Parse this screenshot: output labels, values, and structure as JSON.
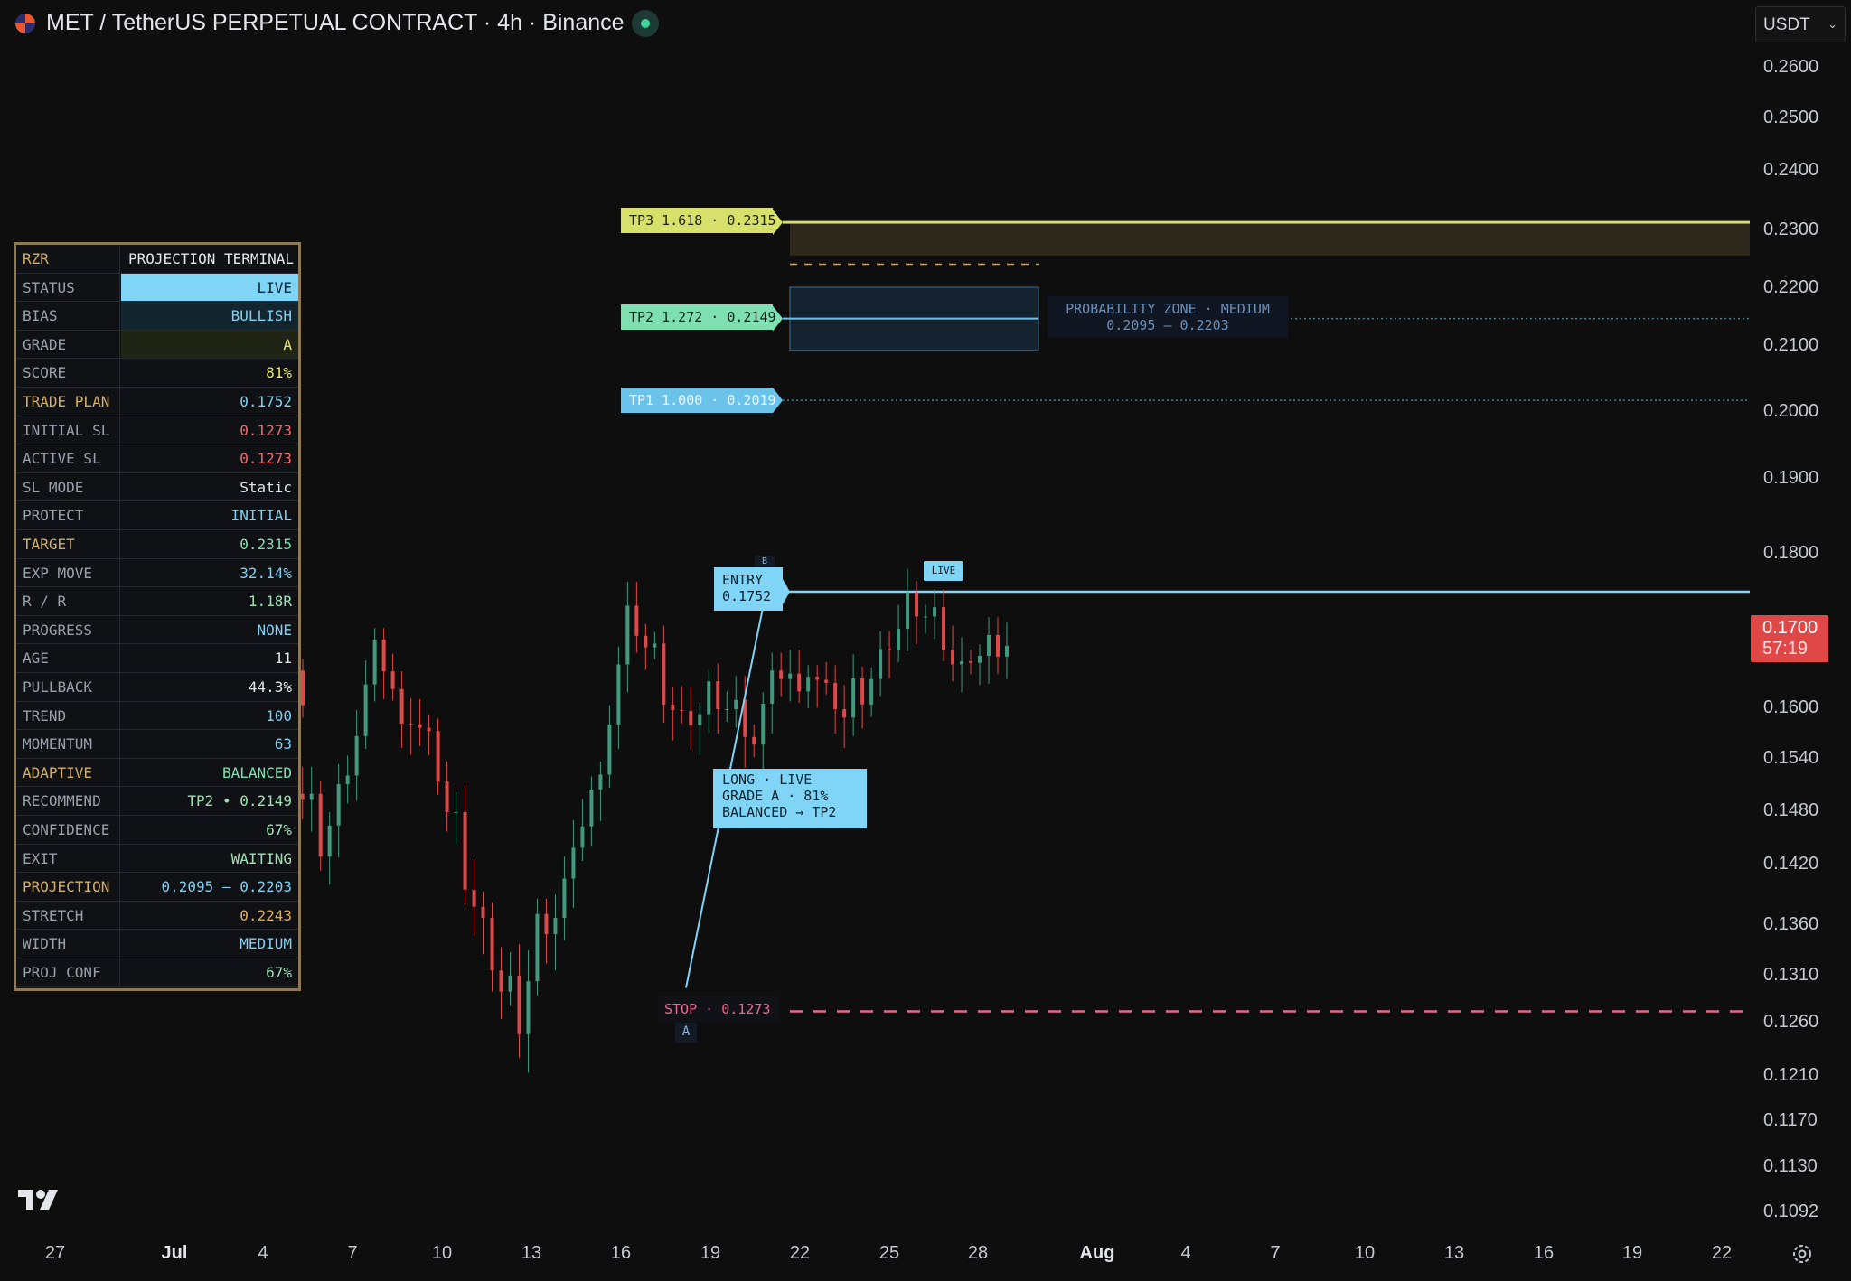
{
  "header": {
    "title": "MET / TetherUS PERPETUAL CONTRACT · 4h · Binance",
    "currency": "USDT"
  },
  "price_axis": {
    "ticks": [
      "0.2600",
      "0.2500",
      "0.2400",
      "0.2300",
      "0.2200",
      "0.2100",
      "0.2000",
      "0.1900",
      "0.1800",
      "0.1600",
      "0.1540",
      "0.1480",
      "0.1420",
      "0.1360",
      "0.1310",
      "0.1260",
      "0.1210",
      "0.1170",
      "0.1130",
      "0.1092"
    ],
    "last_price": "0.1700",
    "countdown": "57:19"
  },
  "time_axis": {
    "ticks": [
      {
        "label": "27",
        "bold": false
      },
      {
        "label": "Jul",
        "bold": true
      },
      {
        "label": "4",
        "bold": false
      },
      {
        "label": "7",
        "bold": false
      },
      {
        "label": "10",
        "bold": false
      },
      {
        "label": "13",
        "bold": false
      },
      {
        "label": "16",
        "bold": false
      },
      {
        "label": "19",
        "bold": false
      },
      {
        "label": "22",
        "bold": false
      },
      {
        "label": "25",
        "bold": false
      },
      {
        "label": "28",
        "bold": false
      },
      {
        "label": "Aug",
        "bold": true
      },
      {
        "label": "4",
        "bold": false
      },
      {
        "label": "7",
        "bold": false
      },
      {
        "label": "10",
        "bold": false
      },
      {
        "label": "13",
        "bold": false
      },
      {
        "label": "16",
        "bold": false
      },
      {
        "label": "19",
        "bold": false
      },
      {
        "label": "22",
        "bold": false
      }
    ]
  },
  "overlay": {
    "tp3": "TP3 1.618 · 0.2315",
    "tp2": "TP2 1.272 · 0.2149",
    "tp1": "TP1 1.000 · 0.2019",
    "zone_line1": "PROBABILITY ZONE · MEDIUM",
    "zone_line2": "0.2095 — 0.2203",
    "entry_line1": "ENTRY",
    "entry_line2": "0.1752",
    "live_tag": "LIVE",
    "signal_line1": "LONG · LIVE",
    "signal_line2": "GRADE A · 81%",
    "signal_line3": "BALANCED → TP2",
    "stop": "STOP · 0.1273",
    "point_a": "A",
    "point_b": "B"
  },
  "terminal": {
    "header_key": "RZR",
    "header_value": "PROJECTION TERMINAL",
    "rows": [
      {
        "key": "STATUS",
        "value": "LIVE",
        "kc": "#9aa0ab",
        "vc": "#0e2230",
        "bg": "#80d4f6"
      },
      {
        "key": "BIAS",
        "value": "BULLISH",
        "kc": "#9aa0ab",
        "vc": "#7fd0f2",
        "bg": "#13252e"
      },
      {
        "key": "GRADE",
        "value": "A",
        "kc": "#9aa0ab",
        "vc": "#e6e46a",
        "bg": "#1f2414"
      },
      {
        "key": "SCORE",
        "value": "81%",
        "kc": "#9aa0ab",
        "vc": "#e6e46a",
        "bg": ""
      },
      {
        "key": "TRADE PLAN",
        "value": "0.1752",
        "kc": "#d4b066",
        "vc": "#7fd0f2",
        "bg": ""
      },
      {
        "key": "INITIAL SL",
        "value": "0.1273",
        "kc": "#9aa0ab",
        "vc": "#ef6b6b",
        "bg": ""
      },
      {
        "key": "ACTIVE SL",
        "value": "0.1273",
        "kc": "#9aa0ab",
        "vc": "#ef6b6b",
        "bg": ""
      },
      {
        "key": "SL MODE",
        "value": "Static",
        "kc": "#9aa0ab",
        "vc": "#e3e5ea",
        "bg": ""
      },
      {
        "key": "PROTECT",
        "value": "INITIAL",
        "kc": "#9aa0ab",
        "vc": "#7fd0f2",
        "bg": ""
      },
      {
        "key": "TARGET",
        "value": "0.2315",
        "kc": "#d4b066",
        "vc": "#7ee0b0",
        "bg": ""
      },
      {
        "key": "EXP MOVE",
        "value": "32.14%",
        "kc": "#9aa0ab",
        "vc": "#7fd0f2",
        "bg": ""
      },
      {
        "key": "R / R",
        "value": "1.18R",
        "kc": "#9aa0ab",
        "vc": "#9ee0b4",
        "bg": ""
      },
      {
        "key": "PROGRESS",
        "value": "NONE",
        "kc": "#9aa0ab",
        "vc": "#7fd0f2",
        "bg": ""
      },
      {
        "key": "AGE",
        "value": "11",
        "kc": "#9aa0ab",
        "vc": "#e3e5ea",
        "bg": ""
      },
      {
        "key": "PULLBACK",
        "value": "44.3%",
        "kc": "#9aa0ab",
        "vc": "#e3e5ea",
        "bg": ""
      },
      {
        "key": "TREND",
        "value": "100",
        "kc": "#9aa0ab",
        "vc": "#7fd0f2",
        "bg": ""
      },
      {
        "key": "MOMENTUM",
        "value": "63",
        "kc": "#9aa0ab",
        "vc": "#7fd0f2",
        "bg": ""
      },
      {
        "key": "ADAPTIVE",
        "value": "BALANCED",
        "kc": "#d4b066",
        "vc": "#7ee0b0",
        "bg": ""
      },
      {
        "key": "RECOMMEND",
        "value": "TP2  •  0.2149",
        "kc": "#9aa0ab",
        "vc": "#9ee0b4",
        "bg": ""
      },
      {
        "key": "CONFIDENCE",
        "value": "67%",
        "kc": "#9aa0ab",
        "vc": "#9ee0b4",
        "bg": ""
      },
      {
        "key": "EXIT",
        "value": "WAITING",
        "kc": "#9aa0ab",
        "vc": "#9ee0b4",
        "bg": ""
      },
      {
        "key": "PROJECTION",
        "value": "0.2095 — 0.2203",
        "kc": "#d4b066",
        "vc": "#7fd0f2",
        "bg": ""
      },
      {
        "key": "STRETCH",
        "value": "0.2243",
        "kc": "#9aa0ab",
        "vc": "#e0b060",
        "bg": ""
      },
      {
        "key": "WIDTH",
        "value": "MEDIUM",
        "kc": "#9aa0ab",
        "vc": "#7fd0f2",
        "bg": ""
      },
      {
        "key": "PROJ CONF",
        "value": "67%",
        "kc": "#9aa0ab",
        "vc": "#9ee0b4",
        "bg": ""
      }
    ]
  },
  "colors": {
    "background": "#0e0e0e",
    "up_candle": "#3f9a7e",
    "down_candle": "#e04848",
    "tp3": "#d6e06a",
    "tp2": "#7ee0b0",
    "tp1": "#6cc3ea",
    "entry": "#80d4f6",
    "stop": "#e86a8e"
  },
  "chart_data": {
    "type": "candlestick",
    "symbol": "MET / TetherUS PERPETUAL CONTRACT",
    "interval": "4h",
    "exchange": "Binance",
    "levels": {
      "tp3": 0.2315,
      "tp2": 0.2149,
      "tp1": 0.2019,
      "entry": 0.1752,
      "stop": 0.1273,
      "zone_low": 0.2095,
      "zone_high": 0.2203
    },
    "last_price": 0.17,
    "approx_closes": [
      0.162,
      0.169,
      0.171,
      0.166,
      0.162,
      0.158,
      0.152,
      0.158,
      0.16,
      0.158,
      0.156,
      0.154,
      0.152,
      0.15,
      0.148,
      0.152,
      0.15,
      0.146,
      0.15,
      0.158,
      0.166,
      0.162,
      0.16,
      0.155,
      0.148,
      0.142,
      0.135,
      0.13,
      0.128,
      0.136,
      0.138,
      0.141,
      0.15,
      0.16,
      0.171,
      0.168,
      0.163,
      0.158,
      0.16,
      0.163,
      0.16,
      0.157,
      0.162,
      0.164,
      0.166,
      0.161,
      0.159,
      0.163,
      0.166,
      0.171,
      0.175,
      0.172,
      0.167,
      0.163,
      0.169,
      0.17
    ]
  }
}
